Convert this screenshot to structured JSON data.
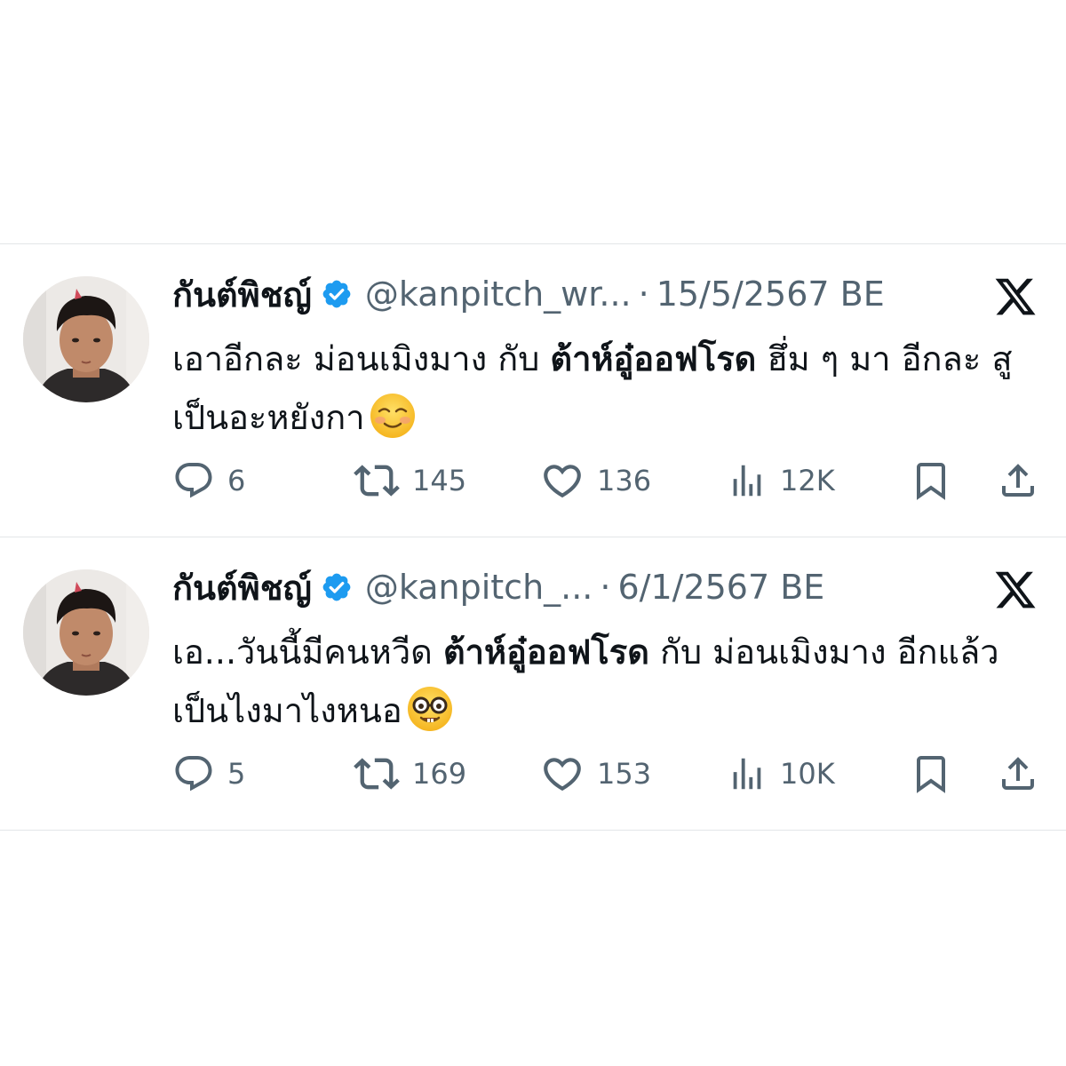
{
  "tweets": [
    {
      "display_name": "กันต์พิชญ์",
      "handle": "@kanpitch_wr...",
      "separator": "·",
      "date": "15/5/2567 BE",
      "text_part1": "เอาอีกละ ม่อนเมิงมาง กับ ",
      "text_bold": "ต้าห์อู๋ออฟโรด",
      "text_part2": " ฮึ่ม ๆ มา อีกละ สูเป็นอะหยังกา",
      "emoji": "smiling-face-emoji",
      "replies": "6",
      "retweets": "145",
      "likes": "136",
      "views": "12K"
    },
    {
      "display_name": "กันต์พิชญ์",
      "handle": "@kanpitch_...",
      "separator": "·",
      "date": "6/1/2567 BE",
      "text_part1": "เอ...วันนี้มีคนหวีด ",
      "text_bold": "ต้าห์อู๋ออฟโรด",
      "text_part2": " กับ ม่อนเมิงมาง อีกแล้ว เป็นไงมาไงหนอ",
      "emoji": "nerd-face-emoji",
      "replies": "5",
      "retweets": "169",
      "likes": "153",
      "views": "10K"
    }
  ],
  "icons": {
    "reply": "reply-icon",
    "retweet": "retweet-icon",
    "like": "like-icon",
    "views": "views-icon",
    "bookmark": "bookmark-icon",
    "share": "share-icon",
    "platform": "x-logo-icon",
    "verified": "verified-badge-icon"
  },
  "colors": {
    "text": "#0f1419",
    "secondary": "#536471",
    "verified": "#1d9bf0",
    "divider": "#e3e6e8"
  }
}
